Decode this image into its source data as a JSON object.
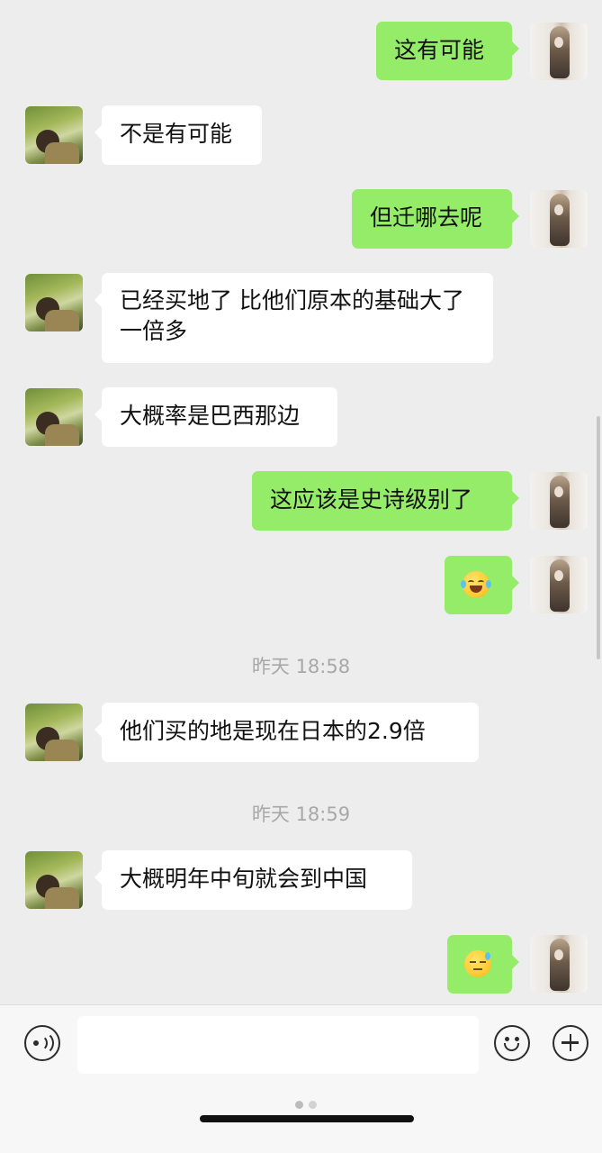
{
  "messages": [
    {
      "side": "right",
      "text": "这有可能"
    },
    {
      "side": "left",
      "text": "不是有可能"
    },
    {
      "side": "right",
      "text": "但迁哪去呢"
    },
    {
      "side": "left",
      "text": "已经买地了 比他们原本的基础大了一倍多"
    },
    {
      "side": "left",
      "text": "大概率是巴西那边"
    },
    {
      "side": "right",
      "text": "这应该是史诗级别了"
    },
    {
      "side": "right",
      "emoji": "tears-of-joy"
    },
    {
      "timestamp": "昨天 18:58"
    },
    {
      "side": "left",
      "text": "他们买的地是现在日本的2.9倍"
    },
    {
      "timestamp": "昨天 18:59"
    },
    {
      "side": "left",
      "text": "大概明年中旬就会到中国"
    },
    {
      "side": "right",
      "emoji": "sweat-smile"
    }
  ],
  "input_bar": {
    "placeholder": "",
    "icons": [
      "voice-icon",
      "emoji-icon",
      "plus-icon"
    ]
  },
  "colors": {
    "background": "#ededed",
    "sent_bubble": "#95ec69",
    "received_bubble": "#ffffff",
    "timestamp_text": "#a8a8a8"
  }
}
